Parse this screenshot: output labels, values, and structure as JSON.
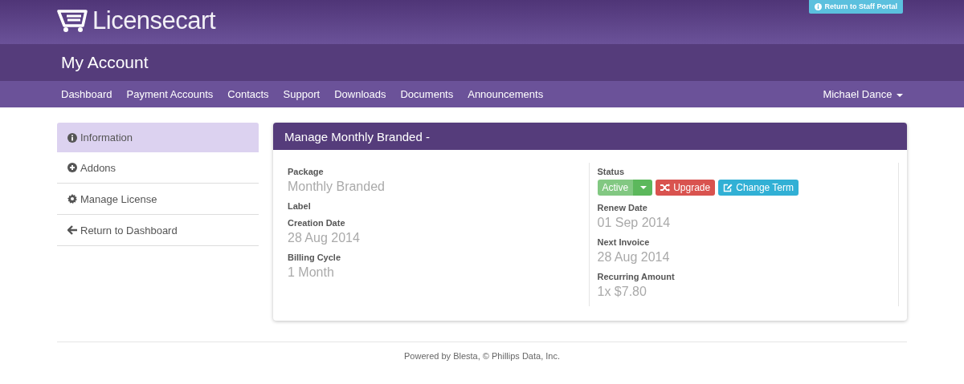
{
  "header": {
    "logo": "**License**cart",
    "staff_button": "Return to Staff Portal"
  },
  "page_title": "My Account",
  "nav": {
    "items": [
      {
        "label": "Dashboard"
      },
      {
        "label": "Payment Accounts"
      },
      {
        "label": "Contacts"
      },
      {
        "label": "Support"
      },
      {
        "label": "Downloads"
      },
      {
        "label": "Documents"
      },
      {
        "label": "Announcements"
      }
    ],
    "user": "Michael Dance"
  },
  "sidebar": {
    "items": [
      {
        "label": "Information",
        "selected": true
      },
      {
        "label": "Addons",
        "selected": false
      },
      {
        "label": "Manage License",
        "selected": false
      },
      {
        "label": "Return to Dashboard",
        "selected": false
      }
    ]
  },
  "panel": {
    "title": "Manage Monthly Branded -",
    "left": [
      {
        "kind": "text",
        "label": "Package",
        "value": "Monthly Branded"
      },
      {
        "kind": "text",
        "label": "Label"
      },
      {
        "kind": "text",
        "label": "Creation Date",
        "value": "28 Aug 2014"
      },
      {
        "kind": "text",
        "label": "Billing Cycle",
        "value": "1 Month"
      }
    ],
    "right": [
      {
        "kind": "buttons",
        "label": "Status",
        "buttons": [
          {
            "kind": "status",
            "label": "Active"
          },
          {
            "kind": "upgrade",
            "label": "Upgrade"
          },
          {
            "kind": "term",
            "label": "Change Term"
          }
        ]
      },
      {
        "kind": "text",
        "label": "Renew Date",
        "value": "01 Sep 2014"
      },
      {
        "kind": "text",
        "label": "Next Invoice",
        "value": "28 Aug 2014"
      },
      {
        "kind": "text",
        "label": "Recurring Amount",
        "value": "1x $7.80"
      }
    ]
  },
  "footer": {
    "prefix": "Powered by ",
    "link": "Blesta",
    "suffix": ", © Phillips Data, Inc."
  }
}
